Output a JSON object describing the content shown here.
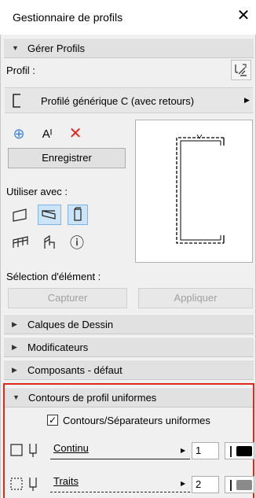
{
  "window": {
    "title": "Gestionnaire de profils",
    "close_glyph": "✕"
  },
  "manage": {
    "label": "Gérer Profils"
  },
  "profil": {
    "label": "Profil :",
    "selected": "Profilé générique C (avec retours)",
    "add_glyph": "⊕",
    "rename_glyph": "Aᴵ",
    "delete_glyph": "✕",
    "save_button": "Enregistrer"
  },
  "use_with": {
    "label": "Utiliser avec :",
    "info_glyph": "ⓘ"
  },
  "element_selection": {
    "label": "Sélection d'élément :",
    "capture_button": "Capturer",
    "apply_button": "Appliquer"
  },
  "sections": [
    {
      "label": "Calques de Dessin"
    },
    {
      "label": "Modificateurs"
    },
    {
      "label": "Composants - défaut"
    },
    {
      "label": "Contours de profil uniformes"
    }
  ],
  "contours": {
    "checkbox_label": "Contours/Séparateurs uniformes",
    "checked": true,
    "rows": [
      {
        "line_type": "Continu",
        "pen": "1"
      },
      {
        "line_type": "Traits",
        "pen": "2"
      }
    ]
  },
  "colors": {
    "accent": "#3b86d6",
    "delete": "#e2281b",
    "highlight": "#e2281b"
  }
}
